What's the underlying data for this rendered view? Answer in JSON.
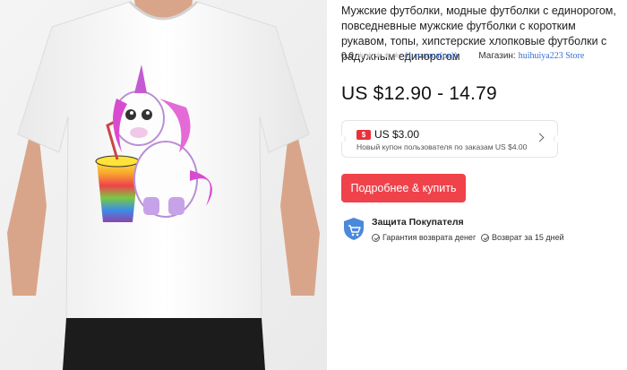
{
  "product": {
    "title": "Мужские футболки, модные футболки с единорогом, повседневные мужские футболки с коротким рукавом, топы, хипстерские хлопковые футболки с радужным единорогом",
    "image_alt": "white t-shirt with rainbow unicorn print"
  },
  "rating": {
    "value": "0.0",
    "votes": "(1 голоса(ов))",
    "stars": [
      "star-icon",
      "star-icon",
      "star-icon",
      "star-icon",
      "star-icon"
    ]
  },
  "store": {
    "label": "Магазин:",
    "name": "huihuiya223 Store"
  },
  "price": {
    "range": "US $12.90 - 14.79"
  },
  "coupon": {
    "tag": "$",
    "amount": "US $3.00",
    "description": "Новый купон пользователя по заказам US $4.00"
  },
  "buy_button": {
    "label": "Подробнее & купить"
  },
  "protection": {
    "title": "Защита Покупателя",
    "guarantees": [
      "Гарантия возврата денег",
      "Возврат за 15 дней"
    ]
  },
  "colors": {
    "accent": "#f0424a",
    "link": "#3a6ed3",
    "shield": "#4a89dc"
  }
}
